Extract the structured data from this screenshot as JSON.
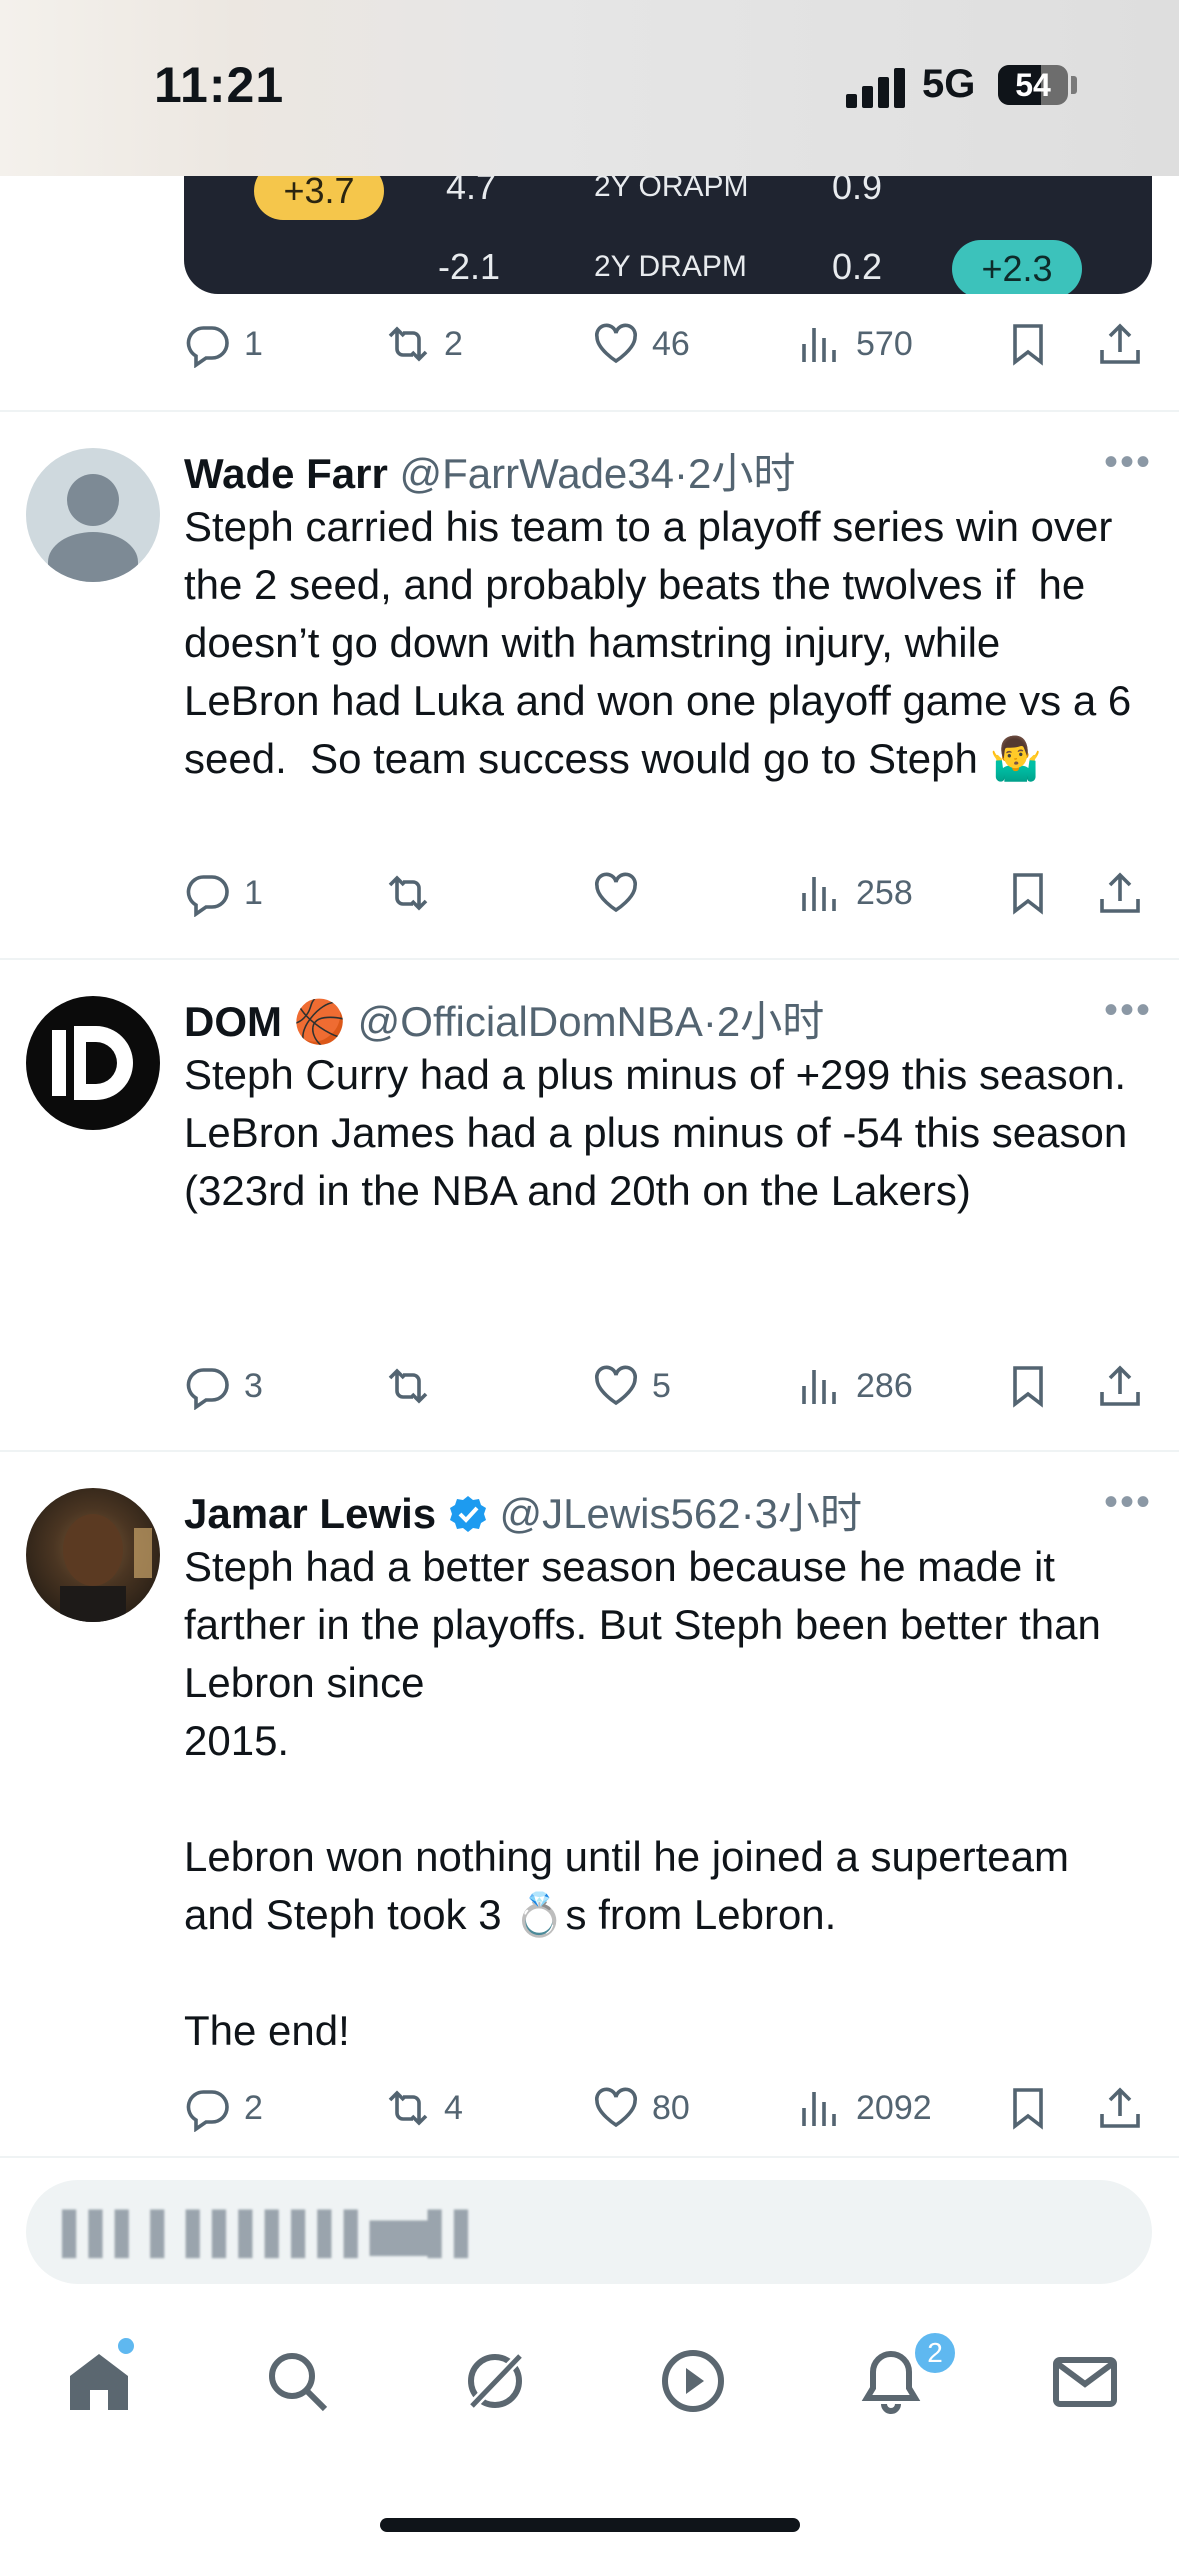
{
  "status": {
    "time": "11:21",
    "network": "5G",
    "battery": "54"
  },
  "stats_card": {
    "row1": {
      "badge": "+3.7",
      "value": "4.7",
      "label": "2Y ORAPM",
      "stat": "0.9"
    },
    "row2": {
      "value": "-2.1",
      "label": "2Y DRAPM",
      "stat": "0.2",
      "badge": "+2.3"
    },
    "colors": {
      "yellow": "#f5c64b",
      "teal": "#3cc2bb"
    }
  },
  "top_actions": {
    "replies": "1",
    "reposts": "2",
    "likes": "46",
    "views": "570"
  },
  "tweets": [
    {
      "name": "Wade Farr",
      "handle": "@FarrWade34",
      "time": "·2小时",
      "body": "Steph carried his team to a playoff series win over the 2 seed, and probably beats the twolves if  he doesn’t go down with hamstring injury, while LeBron had Luka and won one playoff game vs a 6 seed.  So team success would go to Steph 🤷‍♂️",
      "replies": "1",
      "reposts": "",
      "likes": "",
      "views": "258"
    },
    {
      "name": "DOM",
      "name_emoji": "🏀",
      "handle": "@OfficialDomNBA",
      "time": "·2小时",
      "body": "Steph Curry had a plus minus of +299 this season.\nLeBron James had a plus minus of -54 this season (323rd in the NBA and 20th on the Lakers)",
      "replies": "3",
      "reposts": "",
      "likes": "5",
      "views": "286"
    },
    {
      "name": "Jamar Lewis",
      "verified": true,
      "handle": "@JLewis562",
      "time": "·3小时",
      "body": "Steph had a better season because he made it farther in the playoffs. But Steph been better than Lebron since\n2015.\n\nLebron won nothing until he joined a superteam and Steph took 3 💍s from Lebron.\n\nThe end!",
      "replies": "2",
      "reposts": "4",
      "likes": "80",
      "views": "2092"
    }
  ],
  "composer": {
    "placeholder": "▌▌▌ ▌ ▌▌▌▌▌▌▌▆▆▌▌"
  },
  "nav": {
    "notification_count": "2"
  },
  "accent": "#1d9bf0"
}
